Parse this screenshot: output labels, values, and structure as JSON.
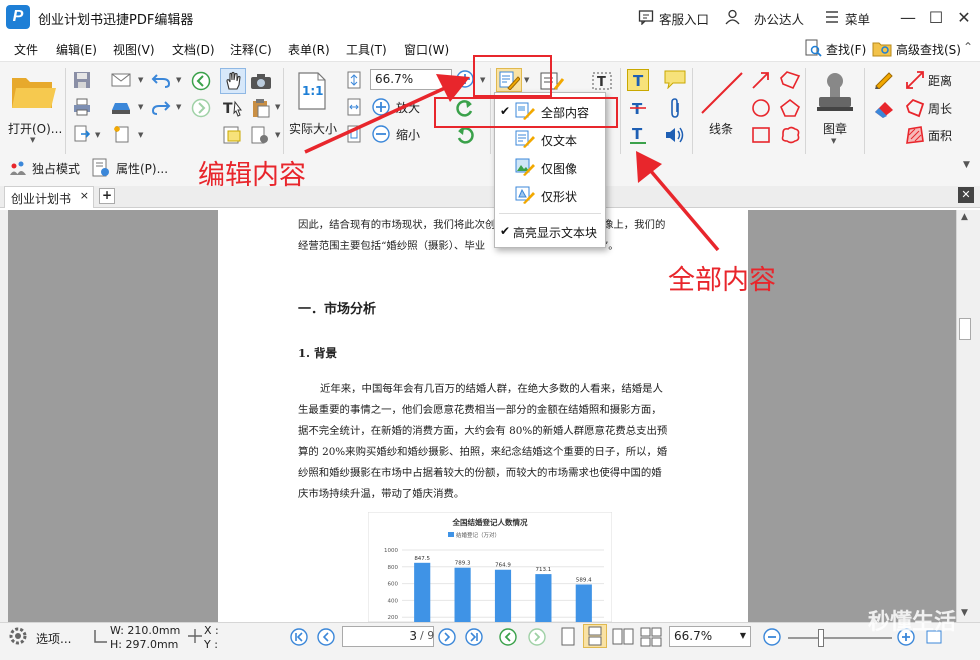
{
  "app": {
    "title": "创业计划书迅捷PDF编辑器",
    "icon_letter": "P",
    "support_label": "客服入口",
    "user_label": "办公达人",
    "menu_label": "菜单"
  },
  "menubar": {
    "items": [
      "文件",
      "编辑(E)",
      "视图(V)",
      "文档(D)",
      "注释(C)",
      "表单(R)",
      "工具(T)",
      "窗口(W)"
    ],
    "find_label": "查找(F)",
    "adv_find_label": "高级查找(S)"
  },
  "toolbar": {
    "open_label": "打开(O)...",
    "actual_size_label": "实际大小",
    "actual_size_icon_text": "1:1",
    "zoom_value": "66.7%",
    "zoom_in_label": "放大",
    "zoom_out_label": "缩小",
    "line_label": "线条",
    "stamp_label": "图章",
    "distance_label": "距离",
    "perimeter_label": "周长",
    "area_label": "面积",
    "exclusive_label": "独占模式",
    "properties_label": "属性(P)..."
  },
  "dropdown": {
    "items": [
      {
        "label": "全部内容",
        "checked": true
      },
      {
        "label": "仅文本",
        "checked": false
      },
      {
        "label": "仅图像",
        "checked": false
      },
      {
        "label": "仅形状",
        "checked": false
      }
    ],
    "highlight_label": "高亮显示文本块",
    "highlight_checked": true
  },
  "annotations": {
    "edit_content": "编辑内容",
    "all_content": "全部内容"
  },
  "tab": {
    "label": "创业计划书"
  },
  "document": {
    "line1": "因此，结合现有的市场现状，我们将此次创",
    "line1b": "像上，我们的",
    "line2": "经营范围主要包括“婚纱照（摄影）、毕业",
    "line2b": "”。",
    "heading1": "一．市场分析",
    "heading2": "1. 背景",
    "para": [
      "近年来，中国每年会有几百万的结婚人群，在绝大多数的人看来，结婚是人",
      "生最重要的事情之一，他们会愿意花费相当一部分的金额在结婚照和摄影方面，",
      "据不完全统计，在新婚的消费方面，大约会有 80%的新婚人群愿意花费总支出预",
      "算的 20%来购买婚纱和婚纱摄影、拍照，来纪念结婚这个重要的日子，所以，婚",
      "纱照和婚纱摄影在市场中占据着较大的份额，而较大的市场需求也使得中国的婚",
      "庆市场持续升温，带动了婚庆消费。"
    ]
  },
  "chart_data": {
    "type": "bar",
    "title": "全国结婚登记人数情况",
    "legend": "结婚登记（万对）",
    "categories": [
      "",
      "",
      "",
      "",
      ""
    ],
    "values": [
      847.5,
      789.3,
      764.9,
      713.1,
      589.4
    ],
    "value_labels": [
      "847.5",
      "789.3",
      "764.9",
      "713.1",
      "589.4"
    ],
    "yticks": [
      "1000",
      "800",
      "600",
      "400",
      "200"
    ],
    "ylim": [
      0,
      1000
    ],
    "bar_color": "#3f93e6"
  },
  "statusbar": {
    "select_label": "选项...",
    "width_label": "W: 210.0mm",
    "height_label": "H: 297.0mm",
    "x_label": "X :",
    "y_label": "Y :",
    "page_value": "3",
    "page_total": "/ 9",
    "zoom_value": "66.7%"
  },
  "watermark": "秒懂生活",
  "colors": {
    "accent": "#1e7fd6",
    "annotation_red": "#e8262c"
  }
}
